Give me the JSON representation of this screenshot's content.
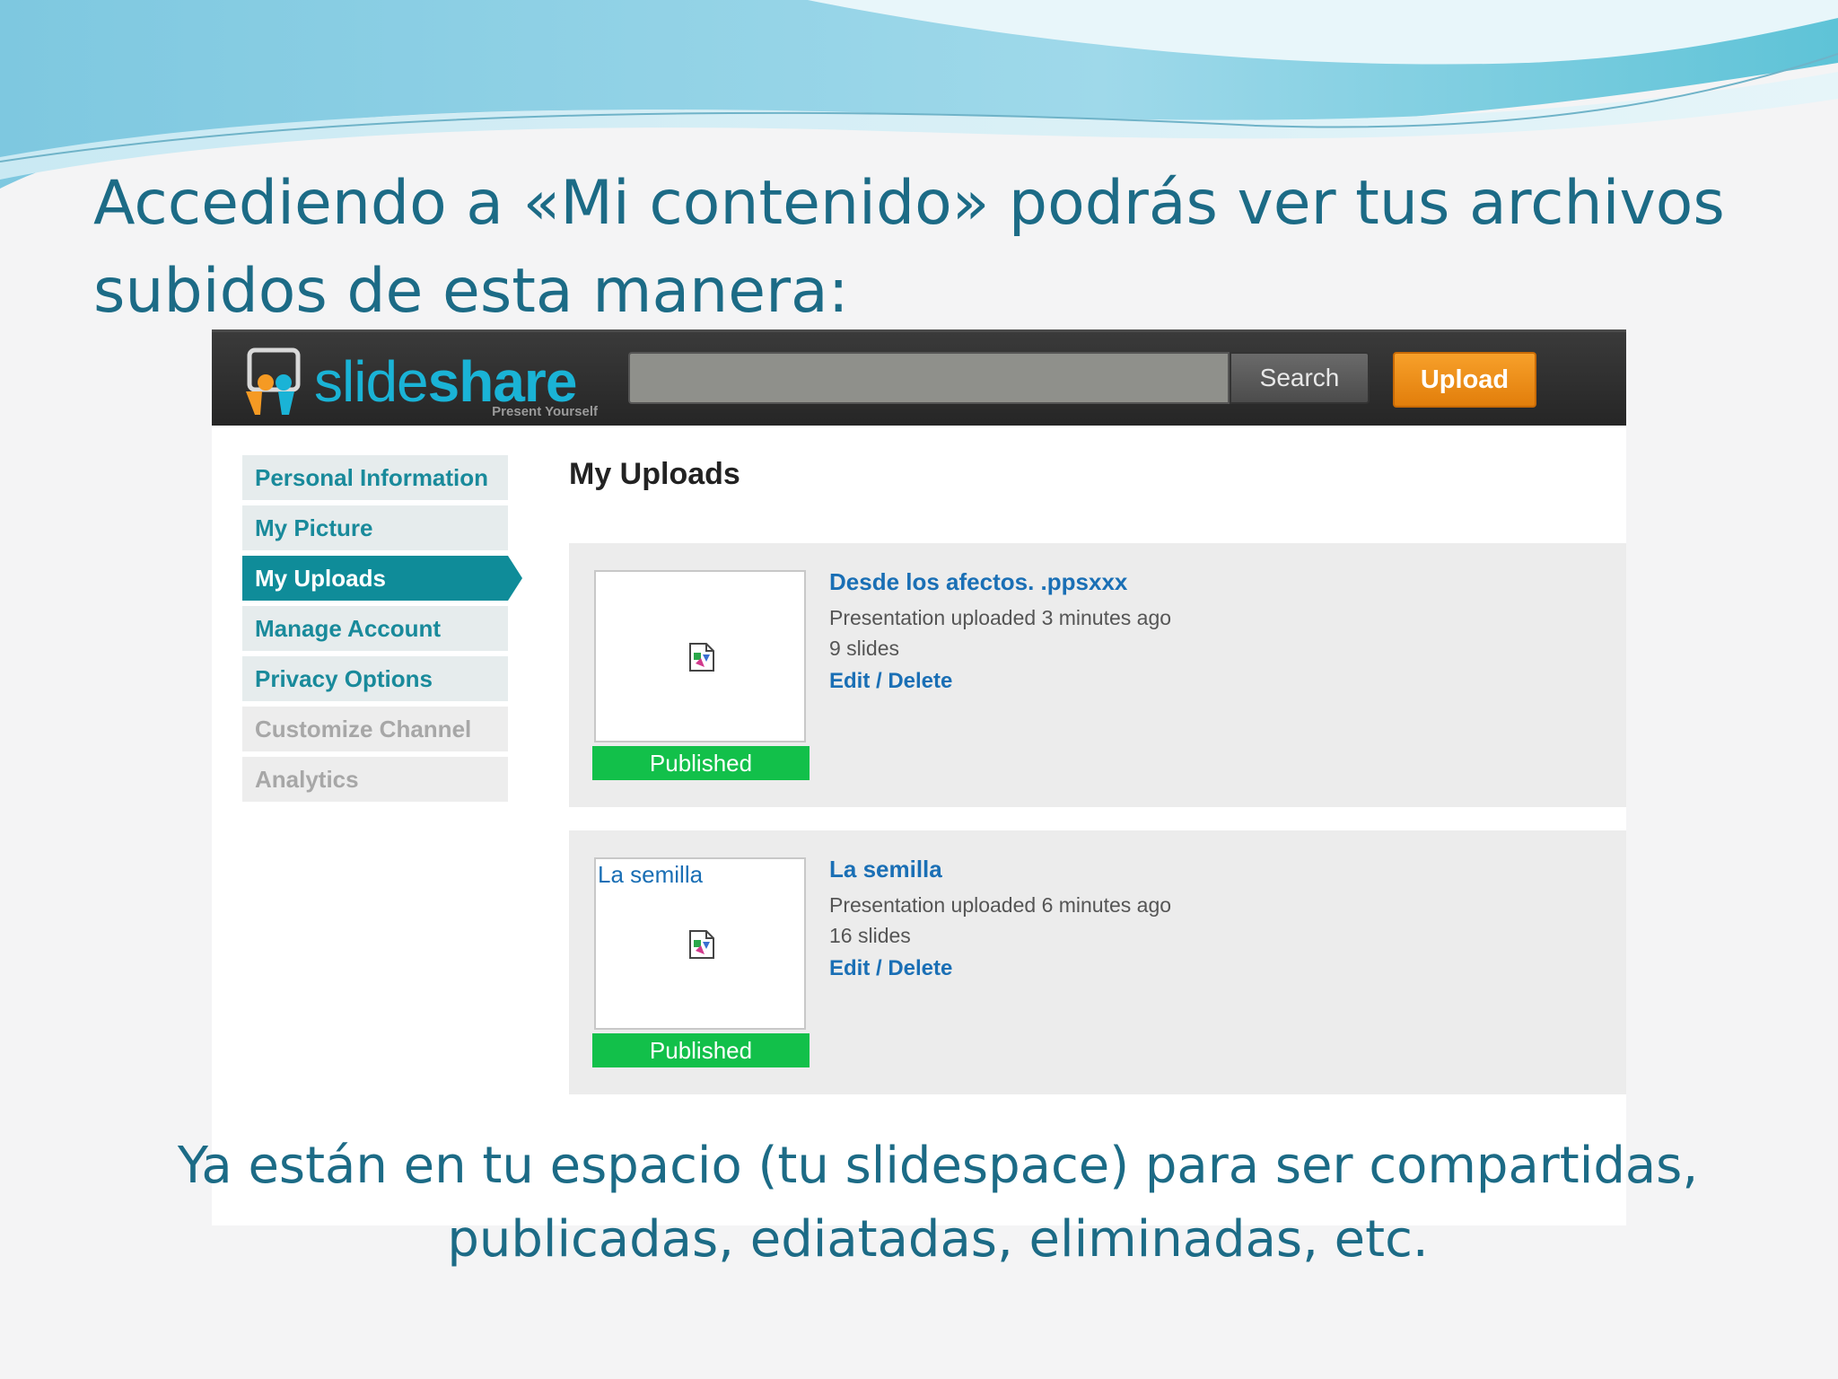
{
  "slide": {
    "title_line1": "Accediendo a «Mi contenido» podrás ver tus archivos",
    "title_line2": "subidos de esta manera:",
    "caption_line1": "Ya están en tu espacio (tu slidespace) para ser compartidas,",
    "caption_line2": "publicadas, ediatadas, eliminadas, etc."
  },
  "header": {
    "logo_text_light": "slide",
    "logo_text_bold": "share",
    "tagline": "Present Yourself",
    "search_value": "",
    "search_label": "Search",
    "upload_label": "Upload"
  },
  "sidebar": {
    "items": [
      {
        "label": "Personal Information",
        "state": "normal"
      },
      {
        "label": "My Picture",
        "state": "normal"
      },
      {
        "label": "My Uploads",
        "state": "active"
      },
      {
        "label": "Manage Account",
        "state": "normal"
      },
      {
        "label": "Privacy Options",
        "state": "normal"
      },
      {
        "label": "Customize Channel",
        "state": "disabled"
      },
      {
        "label": "Analytics",
        "state": "disabled"
      }
    ]
  },
  "main": {
    "title": "My Uploads",
    "uploads": [
      {
        "thumb_caption": "",
        "title": "Desde los afectos. .ppsxxx",
        "uploaded": "Presentation uploaded 3 minutes ago",
        "slides": "9 slides",
        "actions": "Edit / Delete",
        "status": "Published"
      },
      {
        "thumb_caption": "La semilla",
        "title": "La semilla",
        "uploaded": "Presentation uploaded 6 minutes ago",
        "slides": "16 slides",
        "actions": "Edit / Delete",
        "status": "Published"
      }
    ]
  },
  "colors": {
    "title_text": "#1c6b86",
    "accent_teal": "#0f8c99",
    "upload_orange": "#f39217",
    "published_green": "#12c04a",
    "link_blue": "#1a6fb5"
  }
}
